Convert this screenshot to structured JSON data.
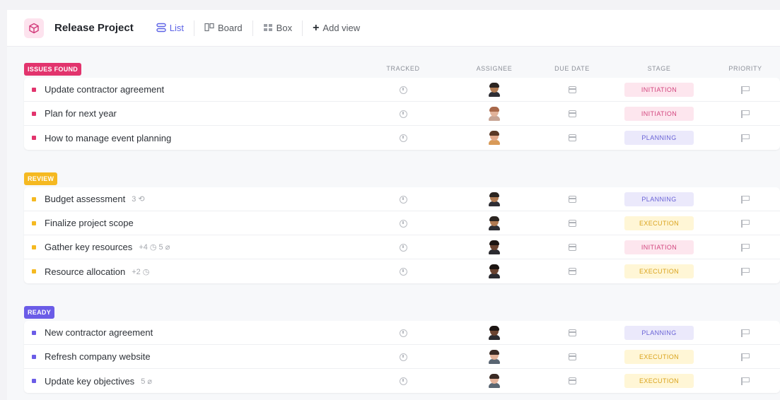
{
  "header": {
    "project_title": "Release Project",
    "project_icon": "cube-icon",
    "views": [
      {
        "label": "List",
        "icon": "list-icon",
        "active": true
      },
      {
        "label": "Board",
        "icon": "board-icon",
        "active": false
      },
      {
        "label": "Box",
        "icon": "box-icon",
        "active": false
      }
    ],
    "add_view_label": "Add view"
  },
  "columns": {
    "tracked": "TRACKED",
    "assignee": "ASSIGNEE",
    "due_date": "DUE DATE",
    "stage": "STAGE",
    "priority": "PRIORITY"
  },
  "stage_colors": {
    "INITIATION": {
      "bg": "#fde6ee",
      "fg": "#d2457e"
    },
    "PLANNING": {
      "bg": "#ebe9fb",
      "fg": "#6a63d6"
    },
    "EXECUTION": {
      "bg": "#fff6d6",
      "fg": "#d9a21b"
    }
  },
  "groups": [
    {
      "name": "ISSUES FOUND",
      "color": "#e2346d",
      "tasks": [
        {
          "name": "Update contractor agreement",
          "extra": "",
          "stage": "INITIATION",
          "avatar": "av1"
        },
        {
          "name": "Plan for next year",
          "extra": "",
          "stage": "INITIATION",
          "avatar": "av2"
        },
        {
          "name": "How to manage event planning",
          "extra": "",
          "stage": "PLANNING",
          "avatar": "av3"
        }
      ]
    },
    {
      "name": "REVIEW",
      "color": "#f5b921",
      "tasks": [
        {
          "name": "Budget assessment",
          "extra": "3 ⟲",
          "stage": "PLANNING",
          "avatar": "av1"
        },
        {
          "name": "Finalize project scope",
          "extra": "",
          "stage": "EXECUTION",
          "avatar": "av1"
        },
        {
          "name": "Gather key resources",
          "extra": "+4 ◷   5 ⌀",
          "stage": "INITIATION",
          "avatar": "av4"
        },
        {
          "name": "Resource allocation",
          "extra": "+2 ◷",
          "stage": "EXECUTION",
          "avatar": "av4"
        }
      ]
    },
    {
      "name": "READY",
      "color": "#6b5ce7",
      "tasks": [
        {
          "name": "New contractor agreement",
          "extra": "",
          "stage": "PLANNING",
          "avatar": "av4"
        },
        {
          "name": "Refresh company website",
          "extra": "",
          "stage": "EXECUTION",
          "avatar": "av5"
        },
        {
          "name": "Update key objectives",
          "extra": "5 ⌀",
          "stage": "EXECUTION",
          "avatar": "av5"
        }
      ]
    }
  ]
}
